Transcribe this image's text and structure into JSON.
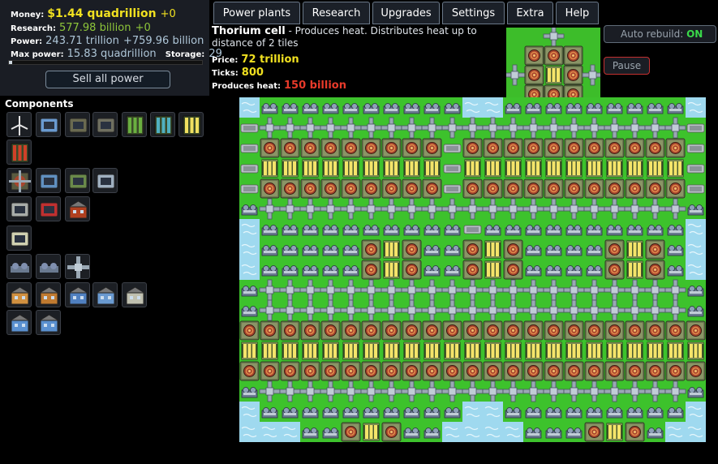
{
  "stats": {
    "money_label": "Money:",
    "money": "$1.44 quadrillion",
    "money_delta": "+0",
    "research_label": "Research:",
    "research": "577.98 billion",
    "research_delta": "+0",
    "power_label": "Power:",
    "power": "243.71 trillion",
    "power_delta": "+759.96 billion",
    "max_power_label": "Max power:",
    "max_power": "15.83 quadrillion",
    "storage_label": "Storage:",
    "storage": "29",
    "power_fill_fraction": 0.015,
    "sell_label": "Sell all power"
  },
  "menu": [
    "Power plants",
    "Research",
    "Upgrades",
    "Settings",
    "Extra",
    "Help"
  ],
  "info": {
    "name": "Thorium cell",
    "description": " - Produces heat. Distributes heat up to distance of 2 tiles",
    "price_label": "Price:",
    "price": "72 trillion",
    "ticks_label": "Ticks:",
    "ticks": "800",
    "heat_label": "Produces heat:",
    "heat": "150 billion"
  },
  "controls": {
    "auto_rebuild_label": "Auto rebuild:",
    "auto_rebuild_state": "ON",
    "pause_label": "Pause"
  },
  "components": {
    "title": "Components",
    "icons": [
      "wind-turbine-icon",
      "solar-panel-icon",
      "coal-burner-icon",
      "gas-burner-icon",
      "uranium-cell-icon",
      "plutonium-cell-icon",
      "thorium-cell-icon",
      "protactinium-cell-icon",
      "heat-exchanger-icon",
      "heat-inlet-icon",
      "heat-outlet-icon",
      "water-pump-icon",
      "insulation-plate-icon",
      "generator-icon",
      "small-office-icon",
      "ground-water-pump-icon",
      "heat-distributor-a-icon",
      "heat-distributor-b-icon",
      "heat-junction-icon",
      "house-icon",
      "shop-icon",
      "lab-icon",
      "library-icon",
      "bank-icon",
      "office-icon",
      "big-office-icon"
    ]
  },
  "colors": {
    "grass": "#3dc22c",
    "water": "#9fd9ef",
    "money": "#f0e020",
    "research": "#8ec63a",
    "heat": "#e83a2a",
    "on": "#3ad94a"
  }
}
